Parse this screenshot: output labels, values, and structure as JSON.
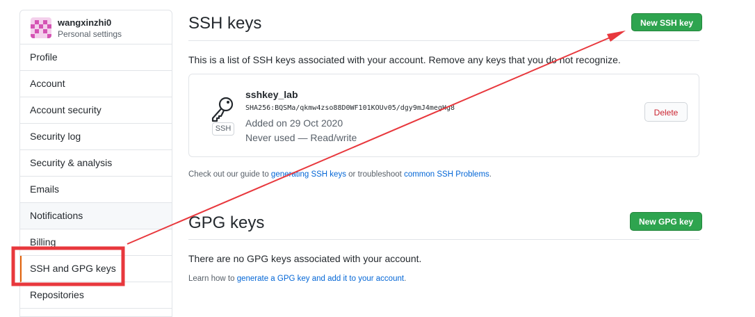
{
  "sidebar": {
    "username": "wangxinzhi0",
    "subtitle": "Personal settings",
    "items": [
      {
        "label": "Profile"
      },
      {
        "label": "Account"
      },
      {
        "label": "Account security"
      },
      {
        "label": "Security log"
      },
      {
        "label": "Security & analysis"
      },
      {
        "label": "Emails"
      },
      {
        "label": "Notifications"
      },
      {
        "label": "Billing"
      },
      {
        "label": "SSH and GPG keys"
      },
      {
        "label": "Repositories"
      }
    ],
    "selected_index": 8
  },
  "ssh": {
    "heading": "SSH keys",
    "new_button": "New SSH key",
    "intro": "This is a list of SSH keys associated with your account. Remove any keys that you do not recognize.",
    "keys": [
      {
        "title": "sshkey_lab",
        "fingerprint": "SHA256:BQSMa/qkmw4zso88D0WF101KOUv05/dgy9mJ4megHg8",
        "added": "Added on 29 Oct 2020",
        "usage": "Never used — Read/write",
        "badge": "SSH",
        "icon": "key-icon",
        "delete_label": "Delete"
      }
    ],
    "guide_prefix": "Check out our guide to ",
    "guide_link": "generating SSH keys",
    "guide_mid": " or troubleshoot ",
    "guide_link2": "common SSH Problems",
    "guide_suffix": "."
  },
  "gpg": {
    "heading": "GPG keys",
    "new_button": "New GPG key",
    "empty": "There are no GPG keys associated with your account.",
    "learn_prefix": "Learn how to ",
    "learn_link": "generate a GPG key and add it to your account",
    "learn_suffix": "."
  },
  "colors": {
    "primary_button": "#2ea44f",
    "link": "#0366d6",
    "danger": "#cb2431",
    "annotation": "#e8383d",
    "selected_marker": "#e36209"
  }
}
